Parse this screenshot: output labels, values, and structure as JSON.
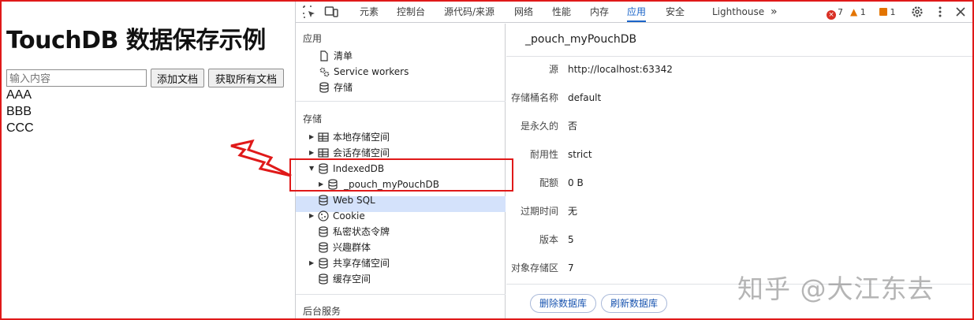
{
  "page": {
    "heading": "TouchDB 数据保存示例",
    "input_placeholder": "输入内容",
    "add_button": "添加文档",
    "get_all_button": "获取所有文档",
    "docs": [
      "AAA",
      "BBB",
      "CCC"
    ]
  },
  "devtools": {
    "tabs": [
      "元素",
      "控制台",
      "源代码/来源",
      "网络",
      "性能",
      "内存",
      "应用",
      "安全",
      "Lighthouse"
    ],
    "active_tab": "应用",
    "more": "»",
    "errors": "7",
    "warnings": "1",
    "issues": "1",
    "sidebar": {
      "section_app": "应用",
      "app_items": [
        "清单",
        "Service workers",
        "存储"
      ],
      "section_storage": "存储",
      "storage_items": [
        "本地存储空间",
        "会话存储空间",
        "IndexedDB",
        "_pouch_myPouchDB",
        "Web SQL",
        "Cookie",
        "私密状态令牌",
        "兴趣群体",
        "共享存储空间",
        "缓存空间"
      ],
      "section_bg": "后台服务"
    },
    "panel": {
      "title": "_pouch_myPouchDB",
      "rows": [
        {
          "k": "源",
          "v": "http://localhost:63342"
        },
        {
          "k": "存储桶名称",
          "v": "default"
        },
        {
          "k": "是永久的",
          "v": "否"
        },
        {
          "k": "耐用性",
          "v": "strict"
        },
        {
          "k": "配额",
          "v": "0 B"
        },
        {
          "k": "过期时间",
          "v": "无"
        },
        {
          "k": "版本",
          "v": "5"
        },
        {
          "k": "对象存储区",
          "v": "7"
        }
      ],
      "delete_button": "删除数据库",
      "refresh_button": "刷新数据库"
    }
  },
  "watermark": "知乎 @大江东去",
  "colors": {
    "accent": "#1a64c8",
    "annotation": "#e01919",
    "selection": "#d4e2fb"
  }
}
